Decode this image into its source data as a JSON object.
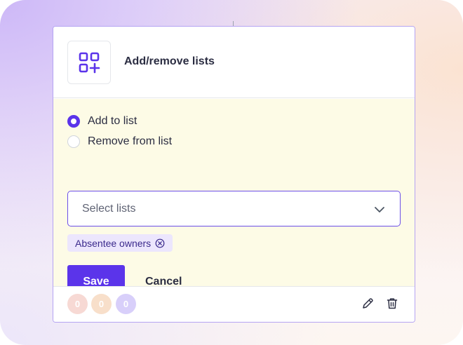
{
  "card": {
    "title": "Add/remove lists",
    "icon": "grid-plus-icon"
  },
  "action_options": [
    {
      "label": "Add to list",
      "checked": true
    },
    {
      "label": "Remove from list",
      "checked": false
    }
  ],
  "lists_select": {
    "placeholder": "Select lists",
    "icon": "chevron-down-icon"
  },
  "selected_tags": [
    {
      "label": "Absentee owners",
      "remove_icon": "close-circle-icon"
    }
  ],
  "buttons": {
    "save_label": "Save",
    "cancel_label": "Cancel"
  },
  "footer": {
    "stats": [
      {
        "value": "0",
        "color": "#f7d9d4"
      },
      {
        "value": "0",
        "color": "#f8dfca"
      },
      {
        "value": "0",
        "color": "#d8cffa"
      }
    ],
    "edit_icon": "pencil-icon",
    "delete_icon": "trash-icon"
  },
  "colors": {
    "accent": "#5b34ea",
    "body_background": "#fdfbe6",
    "tag_background": "#ece6fd"
  }
}
